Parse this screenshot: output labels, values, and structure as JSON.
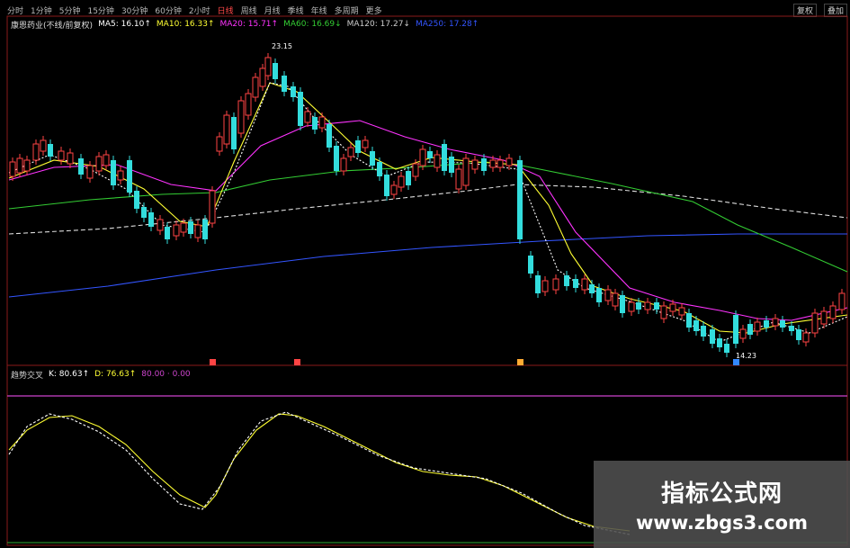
{
  "toolbar": {
    "items": [
      "分时",
      "1分钟",
      "5分钟",
      "15分钟",
      "30分钟",
      "60分钟",
      "2小时",
      "日线",
      "周线",
      "月线",
      "季线",
      "年线",
      "多周期",
      "更多"
    ],
    "active_index": 7,
    "right_buttons": [
      "复权",
      "叠加"
    ]
  },
  "legend": {
    "stock_title": "康恩药业(不线/前复权)",
    "ma": [
      {
        "label": "MA5: 16.10↑",
        "color": "#ffffff"
      },
      {
        "label": "MA10: 16.33↑",
        "color": "#ffff33"
      },
      {
        "label": "MA20: 15.71↑",
        "color": "#ff33ff"
      },
      {
        "label": "MA60: 16.69↓",
        "color": "#33cc33"
      },
      {
        "label": "MA120: 17.27↓",
        "color": "#cccccc"
      },
      {
        "label": "MA250: 17.28↑",
        "color": "#3355ff"
      }
    ]
  },
  "annotations": {
    "peak_label": "23.15",
    "low_label": "14.23"
  },
  "indicator": {
    "name": "趋势交叉",
    "k_label": "K: 80.63↑",
    "d_label": "D: 76.63↑",
    "extra": "80.00 · 0.00",
    "k_color": "#ffffff",
    "d_color": "#ffff33",
    "line_color": "#cc44cc"
  },
  "colors": {
    "up": "#ff4444",
    "down": "#33dddd",
    "ma5": "#ffffff",
    "ma10": "#ffff33",
    "ma20": "#ff33ff",
    "ma60": "#33cc33",
    "ma120": "#dddddd",
    "ma250": "#3355ff"
  },
  "watermark": {
    "title": "指标公式网",
    "url": "www.zbgs3.com"
  }
}
